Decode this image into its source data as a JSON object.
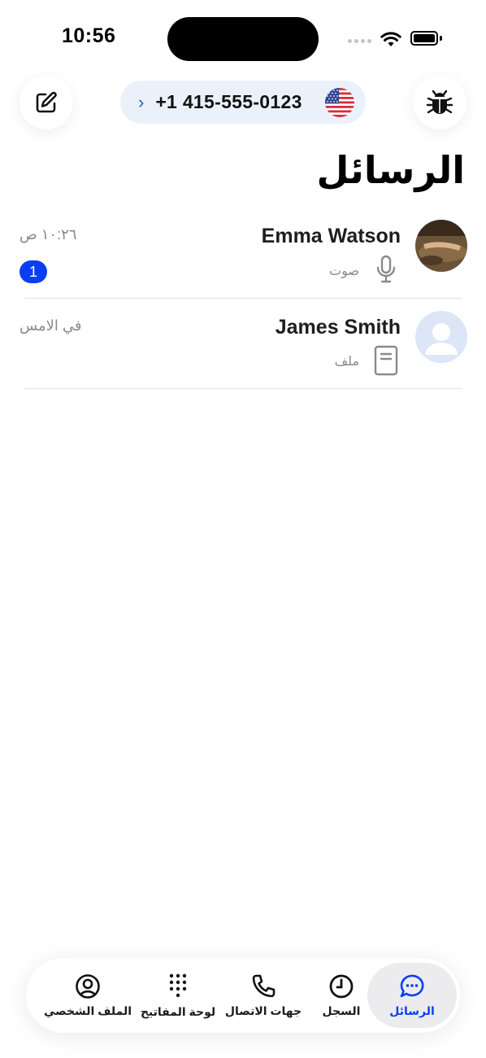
{
  "status_bar": {
    "time": "10:56"
  },
  "header": {
    "phone_number": "+1 415-555-0123",
    "compose_icon": "compose-icon",
    "bug_icon": "bug-icon",
    "flag_icon": "us-flag-icon"
  },
  "page": {
    "title": "الرسائل"
  },
  "conversations": [
    {
      "name": "Emma Watson",
      "time": "١٠:٢٦ ص",
      "preview": "صوت",
      "preview_icon": "microphone-icon",
      "unread": "1"
    },
    {
      "name": "James Smith",
      "time": "في الامس",
      "preview": "ملف",
      "preview_icon": "document-icon",
      "unread": ""
    }
  ],
  "tabbar": {
    "tabs": [
      {
        "label": "الرسائل",
        "icon": "chat-bubble-icon",
        "active": true
      },
      {
        "label": "السجل",
        "icon": "clock-icon",
        "active": false
      },
      {
        "label": "جهات الاتصال",
        "icon": "phone-icon",
        "active": false
      },
      {
        "label": "لوحة المفاتيح",
        "icon": "keypad-icon",
        "active": false
      },
      {
        "label": "الملف الشخصي",
        "icon": "profile-icon",
        "active": false
      }
    ]
  },
  "colors": {
    "accent": "#0a3ef5",
    "pill_background": "#eaf1fa"
  }
}
